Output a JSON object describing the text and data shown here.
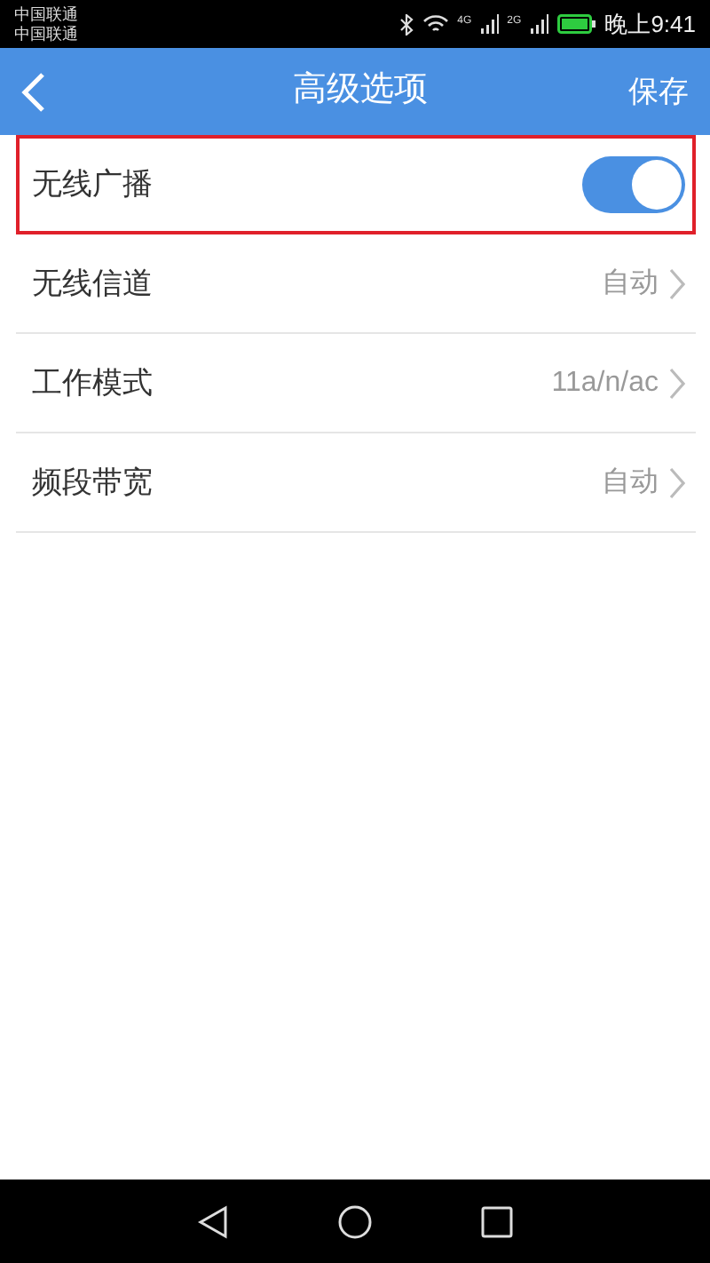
{
  "status_bar": {
    "carriers": [
      "中国联通",
      "中国联通"
    ],
    "network_1": "4G",
    "network_2": "2G",
    "time": "晚上9:41"
  },
  "header": {
    "title": "高级选项",
    "action": "保存"
  },
  "settings": [
    {
      "kind": "toggle",
      "label": "无线广播",
      "on": true,
      "highlighted": true
    },
    {
      "kind": "select",
      "label": "无线信道",
      "value": "自动",
      "highlighted": false
    },
    {
      "kind": "select",
      "label": "工作模式",
      "value": "11a/n/ac",
      "highlighted": false
    },
    {
      "kind": "select",
      "label": "频段带宽",
      "value": "自动",
      "highlighted": false
    }
  ]
}
